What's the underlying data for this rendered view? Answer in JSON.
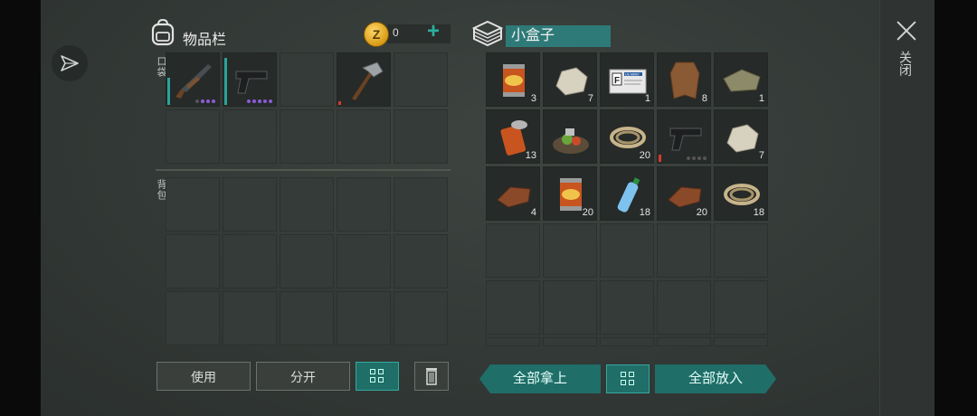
{
  "inventory": {
    "title": "物品栏",
    "pockets_label": "口袋",
    "backpack_label": "背包",
    "coins": "0",
    "coin_symbol": "Z",
    "pocket_items": [
      {
        "name": "shotgun",
        "icon": "shotgun-icon"
      },
      {
        "name": "pistol",
        "icon": "pistol-icon"
      },
      {
        "name": "",
        "icon": ""
      },
      {
        "name": "hatchet",
        "icon": "hatchet-icon"
      },
      {
        "name": "",
        "icon": ""
      }
    ]
  },
  "container": {
    "name": "小盒子",
    "items": [
      {
        "icon": "canned-food-icon",
        "qty": "3"
      },
      {
        "icon": "stone-icon",
        "qty": "7"
      },
      {
        "icon": "id-card-icon",
        "qty": "1",
        "card_text": "F",
        "card_header": "US ARMY"
      },
      {
        "icon": "leather-hide-icon",
        "qty": "8"
      },
      {
        "icon": "cloth-icon",
        "qty": "1"
      },
      {
        "icon": "open-can-icon",
        "qty": "13"
      },
      {
        "icon": "food-pile-icon",
        "qty": ""
      },
      {
        "icon": "rope-icon",
        "qty": "20"
      },
      {
        "icon": "pistol-icon",
        "qty": ""
      },
      {
        "icon": "stone-icon",
        "qty": "7"
      },
      {
        "icon": "leather-icon",
        "qty": "4"
      },
      {
        "icon": "canned-food-icon",
        "qty": "20"
      },
      {
        "icon": "water-bottle-icon",
        "qty": "18"
      },
      {
        "icon": "leather-icon",
        "qty": "20"
      },
      {
        "icon": "rope-icon",
        "qty": "18"
      }
    ]
  },
  "buttons": {
    "use": "使用",
    "split": "分开",
    "take_all": "全部拿上",
    "put_all": "全部放入",
    "close": "关闭"
  },
  "colors": {
    "teal": "#1f6e68",
    "accent": "#2ab0a0"
  }
}
